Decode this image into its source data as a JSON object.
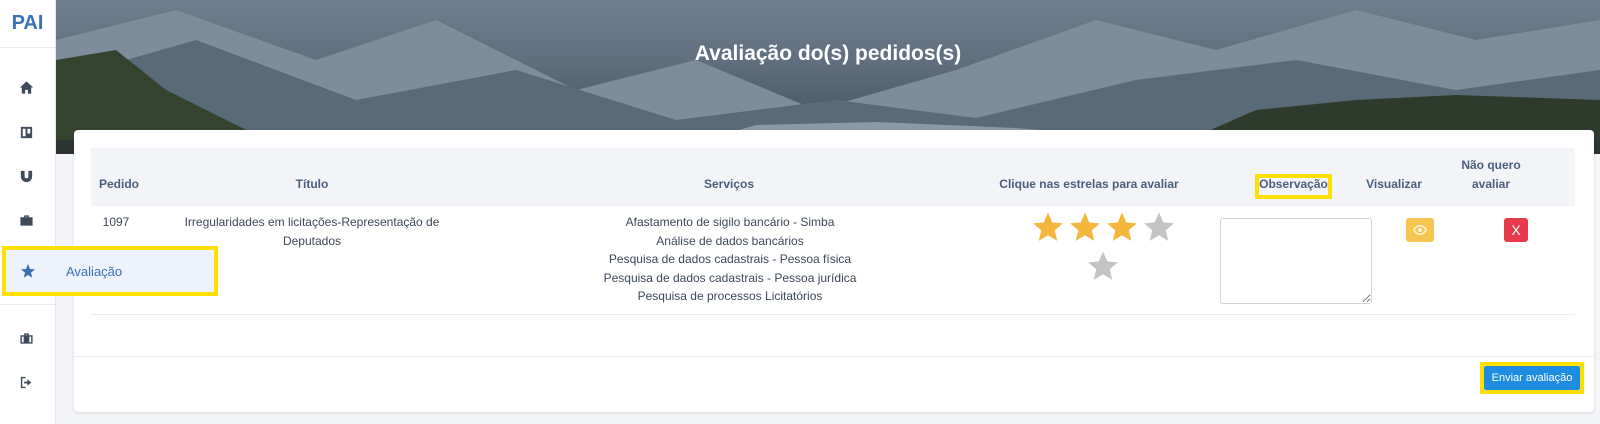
{
  "brand": "PAI",
  "sidebar": {
    "active_label": "Avaliação",
    "icons": [
      "home-icon",
      "board-icon",
      "magnet-icon",
      "briefcase-icon",
      "star-icon",
      "toolbox-icon",
      "logout-icon"
    ]
  },
  "page_title": "Avaliação do(s) pedidos(s)",
  "table": {
    "headers": {
      "pedido": "Pedido",
      "titulo": "Título",
      "servicos": "Serviços",
      "estrelas": "Clique nas estrelas para avaliar",
      "observacao": "Observação",
      "visualizar": "Visualizar",
      "nao_quero_1": "Não quero",
      "nao_quero_2": "avaliar"
    },
    "row": {
      "pedido": "1097",
      "titulo_1": "Irregularidades em licitações-Representação de",
      "titulo_2": "Deputados",
      "servicos": [
        "Afastamento de sigilo bancário - Simba",
        "Análise de dados bancários",
        "Pesquisa de dados cadastrais - Pessoa física",
        "Pesquisa de dados cadastrais - Pessoa jurídica",
        "Pesquisa de processos Licitatórios"
      ],
      "rating": 3,
      "rating_max": 5,
      "observacao": "",
      "decline_label": "X"
    }
  },
  "submit_label": "Enviar avaliação",
  "colors": {
    "accent": "#1e8ce0",
    "highlight": "#ffe100",
    "star_on": "#f4b63d",
    "star_off": "#c4c4c4",
    "view_button": "#f6c550",
    "decline_button": "#e53b4b"
  }
}
